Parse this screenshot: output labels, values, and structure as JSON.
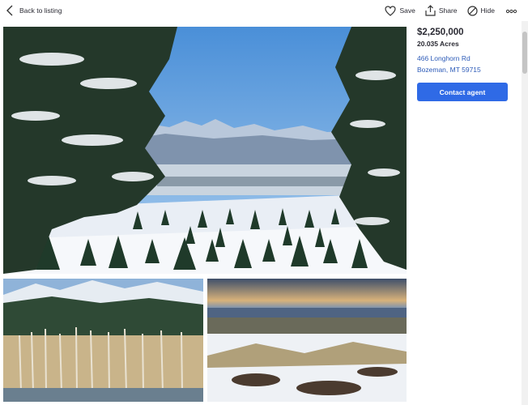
{
  "nav": {
    "back_label": "Back to listing",
    "back_icon": "chevron-left-icon"
  },
  "actions": [
    {
      "label": "Save",
      "icon": "heart-icon"
    },
    {
      "label": "Share",
      "icon": "share-icon"
    },
    {
      "label": "Hide",
      "icon": "hide-icon"
    },
    {
      "label": "",
      "icon": "more-icon"
    }
  ],
  "listing": {
    "price": "$2,250,000",
    "acres": "20.035 Acres",
    "address_line1": "466 Longhorn Rd",
    "address_line2": "Bozeman, MT 59715",
    "contact_label": "Contact agent"
  },
  "photos": [
    {
      "subject": "snowy evergreen meadow with mountain view"
    },
    {
      "subject": "aspen grove with mountains and pond"
    },
    {
      "subject": "sunset over snowy valley"
    }
  ],
  "colors": {
    "accent": "#2f6ae6",
    "link": "#2d5bb8",
    "text": "#2a2a33"
  }
}
